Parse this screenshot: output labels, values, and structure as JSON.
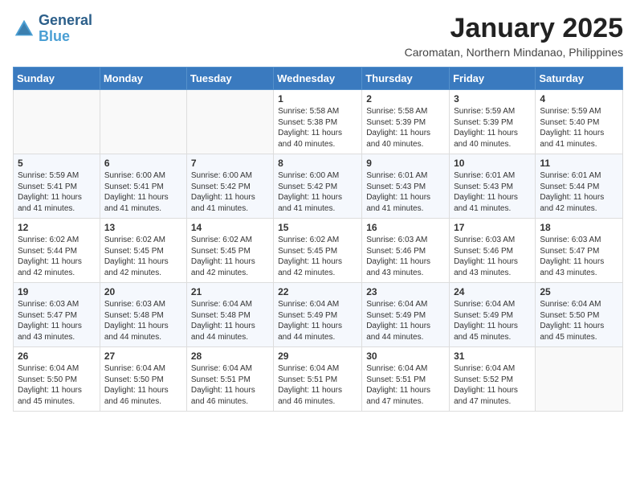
{
  "logo": {
    "line1": "General",
    "line2": "Blue"
  },
  "title": "January 2025",
  "subtitle": "Caromatan, Northern Mindanao, Philippines",
  "weekdays": [
    "Sunday",
    "Monday",
    "Tuesday",
    "Wednesday",
    "Thursday",
    "Friday",
    "Saturday"
  ],
  "weeks": [
    [
      {
        "day": "",
        "info": ""
      },
      {
        "day": "",
        "info": ""
      },
      {
        "day": "",
        "info": ""
      },
      {
        "day": "1",
        "info": "Sunrise: 5:58 AM\nSunset: 5:38 PM\nDaylight: 11 hours\nand 40 minutes."
      },
      {
        "day": "2",
        "info": "Sunrise: 5:58 AM\nSunset: 5:39 PM\nDaylight: 11 hours\nand 40 minutes."
      },
      {
        "day": "3",
        "info": "Sunrise: 5:59 AM\nSunset: 5:39 PM\nDaylight: 11 hours\nand 40 minutes."
      },
      {
        "day": "4",
        "info": "Sunrise: 5:59 AM\nSunset: 5:40 PM\nDaylight: 11 hours\nand 41 minutes."
      }
    ],
    [
      {
        "day": "5",
        "info": "Sunrise: 5:59 AM\nSunset: 5:41 PM\nDaylight: 11 hours\nand 41 minutes."
      },
      {
        "day": "6",
        "info": "Sunrise: 6:00 AM\nSunset: 5:41 PM\nDaylight: 11 hours\nand 41 minutes."
      },
      {
        "day": "7",
        "info": "Sunrise: 6:00 AM\nSunset: 5:42 PM\nDaylight: 11 hours\nand 41 minutes."
      },
      {
        "day": "8",
        "info": "Sunrise: 6:00 AM\nSunset: 5:42 PM\nDaylight: 11 hours\nand 41 minutes."
      },
      {
        "day": "9",
        "info": "Sunrise: 6:01 AM\nSunset: 5:43 PM\nDaylight: 11 hours\nand 41 minutes."
      },
      {
        "day": "10",
        "info": "Sunrise: 6:01 AM\nSunset: 5:43 PM\nDaylight: 11 hours\nand 41 minutes."
      },
      {
        "day": "11",
        "info": "Sunrise: 6:01 AM\nSunset: 5:44 PM\nDaylight: 11 hours\nand 42 minutes."
      }
    ],
    [
      {
        "day": "12",
        "info": "Sunrise: 6:02 AM\nSunset: 5:44 PM\nDaylight: 11 hours\nand 42 minutes."
      },
      {
        "day": "13",
        "info": "Sunrise: 6:02 AM\nSunset: 5:45 PM\nDaylight: 11 hours\nand 42 minutes."
      },
      {
        "day": "14",
        "info": "Sunrise: 6:02 AM\nSunset: 5:45 PM\nDaylight: 11 hours\nand 42 minutes."
      },
      {
        "day": "15",
        "info": "Sunrise: 6:02 AM\nSunset: 5:45 PM\nDaylight: 11 hours\nand 42 minutes."
      },
      {
        "day": "16",
        "info": "Sunrise: 6:03 AM\nSunset: 5:46 PM\nDaylight: 11 hours\nand 43 minutes."
      },
      {
        "day": "17",
        "info": "Sunrise: 6:03 AM\nSunset: 5:46 PM\nDaylight: 11 hours\nand 43 minutes."
      },
      {
        "day": "18",
        "info": "Sunrise: 6:03 AM\nSunset: 5:47 PM\nDaylight: 11 hours\nand 43 minutes."
      }
    ],
    [
      {
        "day": "19",
        "info": "Sunrise: 6:03 AM\nSunset: 5:47 PM\nDaylight: 11 hours\nand 43 minutes."
      },
      {
        "day": "20",
        "info": "Sunrise: 6:03 AM\nSunset: 5:48 PM\nDaylight: 11 hours\nand 44 minutes."
      },
      {
        "day": "21",
        "info": "Sunrise: 6:04 AM\nSunset: 5:48 PM\nDaylight: 11 hours\nand 44 minutes."
      },
      {
        "day": "22",
        "info": "Sunrise: 6:04 AM\nSunset: 5:49 PM\nDaylight: 11 hours\nand 44 minutes."
      },
      {
        "day": "23",
        "info": "Sunrise: 6:04 AM\nSunset: 5:49 PM\nDaylight: 11 hours\nand 44 minutes."
      },
      {
        "day": "24",
        "info": "Sunrise: 6:04 AM\nSunset: 5:49 PM\nDaylight: 11 hours\nand 45 minutes."
      },
      {
        "day": "25",
        "info": "Sunrise: 6:04 AM\nSunset: 5:50 PM\nDaylight: 11 hours\nand 45 minutes."
      }
    ],
    [
      {
        "day": "26",
        "info": "Sunrise: 6:04 AM\nSunset: 5:50 PM\nDaylight: 11 hours\nand 45 minutes."
      },
      {
        "day": "27",
        "info": "Sunrise: 6:04 AM\nSunset: 5:50 PM\nDaylight: 11 hours\nand 46 minutes."
      },
      {
        "day": "28",
        "info": "Sunrise: 6:04 AM\nSunset: 5:51 PM\nDaylight: 11 hours\nand 46 minutes."
      },
      {
        "day": "29",
        "info": "Sunrise: 6:04 AM\nSunset: 5:51 PM\nDaylight: 11 hours\nand 46 minutes."
      },
      {
        "day": "30",
        "info": "Sunrise: 6:04 AM\nSunset: 5:51 PM\nDaylight: 11 hours\nand 47 minutes."
      },
      {
        "day": "31",
        "info": "Sunrise: 6:04 AM\nSunset: 5:52 PM\nDaylight: 11 hours\nand 47 minutes."
      },
      {
        "day": "",
        "info": ""
      }
    ]
  ]
}
